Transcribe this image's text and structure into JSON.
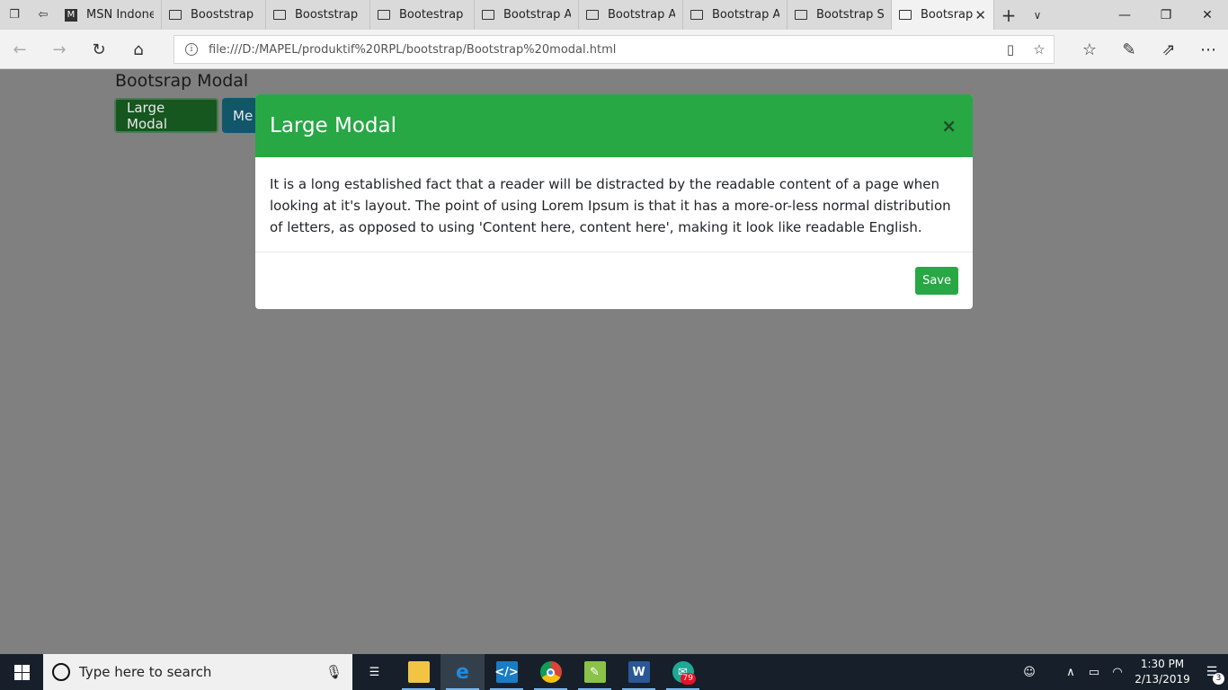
{
  "browser": {
    "tabs": [
      {
        "label": "MSN Indonesia",
        "icon": "msn-icon"
      },
      {
        "label": "Booststrap C",
        "icon": "page-icon"
      },
      {
        "label": "Booststrap Gr",
        "icon": "page-icon"
      },
      {
        "label": "Bootestrap",
        "icon": "page-icon"
      },
      {
        "label": "Bootstrap Al",
        "icon": "page-icon"
      },
      {
        "label": "Bootstrap Al",
        "icon": "page-icon"
      },
      {
        "label": "Bootstrap Al",
        "icon": "page-icon"
      },
      {
        "label": "Bootstrap Sli",
        "icon": "page-icon"
      },
      {
        "label": "Bootsrap",
        "icon": "page-icon",
        "active": true
      }
    ],
    "address": "file:///D:/MAPEL/produktif%20RPL/bootstrap/Bootstrap%20modal.html"
  },
  "page": {
    "title": "Bootsrap Modal",
    "buttons": {
      "large": "Large Modal",
      "medium": "Me"
    }
  },
  "modal": {
    "title": "Large Modal",
    "close_glyph": "×",
    "body": "It is a long established fact that a reader will be distracted by the readable content of a page when looking at it's layout. The point of using Lorem Ipsum is that it has a more-or-less normal distribution of letters, as opposed to using 'Content here, content here', making it look like readable English.",
    "save_label": "Save"
  },
  "taskbar": {
    "search_placeholder": "Type here to search",
    "apps": [
      {
        "name": "task-view",
        "icon": "task-view-icon"
      },
      {
        "name": "file-explorer",
        "icon": "folder-icon"
      },
      {
        "name": "edge",
        "icon": "edge-icon"
      },
      {
        "name": "vscode",
        "icon": "vscode-icon"
      },
      {
        "name": "chrome",
        "icon": "chrome-icon"
      },
      {
        "name": "notepad-plus",
        "icon": "notepad-icon"
      },
      {
        "name": "word",
        "icon": "word-icon"
      },
      {
        "name": "whatsapp",
        "icon": "chat-icon",
        "badge": "79"
      }
    ],
    "time": "1:30 PM",
    "date": "2/13/2019",
    "notifications": "3"
  },
  "colors": {
    "success": "#28a745",
    "overlay": "#808080",
    "taskbar": "#17202a"
  }
}
